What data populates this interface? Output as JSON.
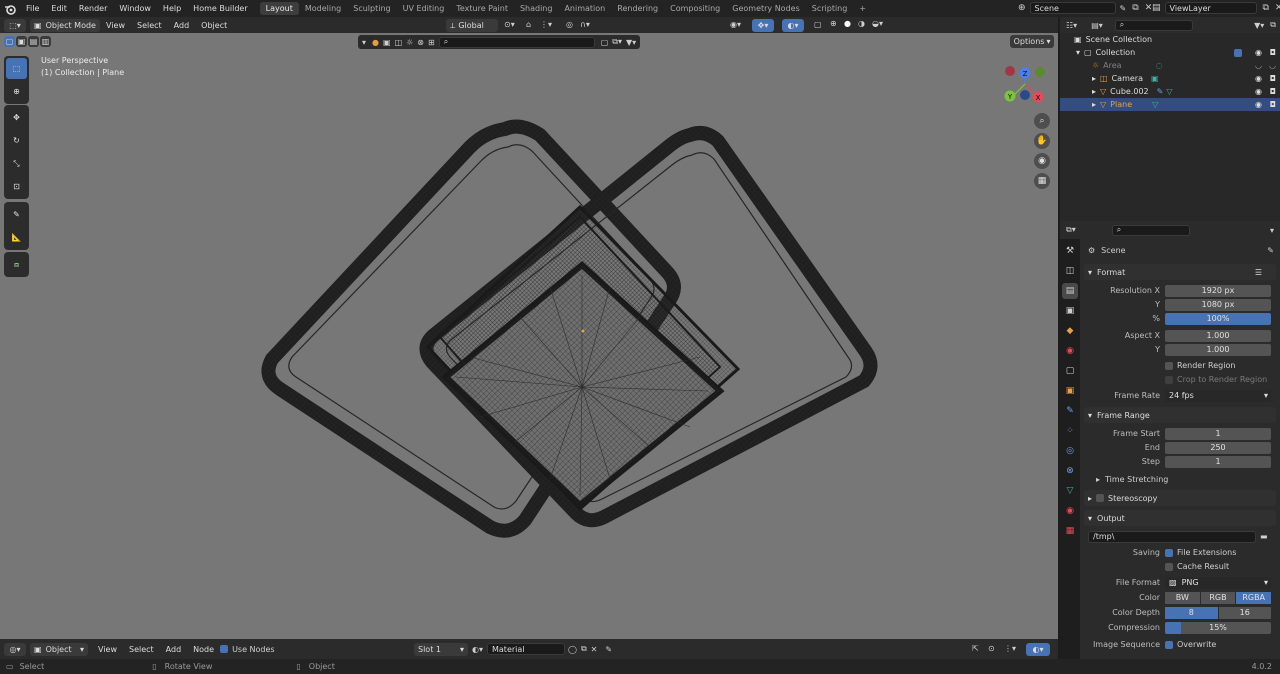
{
  "menus": [
    "File",
    "Edit",
    "Render",
    "Window",
    "Help",
    "Home Builder"
  ],
  "workspaces": [
    "Layout",
    "Modeling",
    "Sculpting",
    "UV Editing",
    "Texture Paint",
    "Shading",
    "Animation",
    "Rendering",
    "Compositing",
    "Geometry Nodes",
    "Scripting"
  ],
  "active_workspace": "Layout",
  "add_workspace": "+",
  "scene_name": "Scene",
  "view_layer": "ViewLayer",
  "viewport": {
    "mode": "Object Mode",
    "header_menus": [
      "View",
      "Select",
      "Add",
      "Object"
    ],
    "transform_orientation": "Global",
    "options_label": "Options",
    "perspective_label": "User Perspective",
    "collection_label": "(1) Collection | Plane",
    "gizmo_axes": {
      "x": "X",
      "y": "Y",
      "z": "Z"
    }
  },
  "bottom_bar": {
    "editor_mode": "Object",
    "menus": [
      "View",
      "Select",
      "Add",
      "Node"
    ],
    "use_nodes_label": "Use Nodes",
    "slot": "Slot 1",
    "material": "Material"
  },
  "status_bar": {
    "select": "Select",
    "rotate_view": "Rotate View",
    "object": "Object",
    "version": "4.0.2"
  },
  "outliner": {
    "scene_collection": "Scene Collection",
    "collection": "Collection",
    "items": [
      {
        "name": "Area",
        "dim": true
      },
      {
        "name": "Camera",
        "dim": false
      },
      {
        "name": "Cube.002",
        "dim": false
      },
      {
        "name": "Plane",
        "dim": false,
        "selected": true
      }
    ]
  },
  "properties": {
    "context": "Scene",
    "format_panel": {
      "title": "Format",
      "resolution_x_label": "Resolution X",
      "resolution_x": "1920 px",
      "y_label": "Y",
      "resolution_y": "1080 px",
      "percent_label": "%",
      "percent": "100%",
      "percent_fraction": 1.0,
      "aspect_x_label": "Aspect X",
      "aspect_x": "1.000",
      "aspect_y_label": "Y",
      "aspect_y": "1.000",
      "render_region": "Render Region",
      "crop_region": "Crop to Render Region",
      "frame_rate_label": "Frame Rate",
      "frame_rate": "24 fps"
    },
    "frame_range_panel": {
      "title": "Frame Range",
      "frame_start_label": "Frame Start",
      "frame_start": "1",
      "end_label": "End",
      "end": "250",
      "step_label": "Step",
      "step": "1",
      "time_stretching": "Time Stretching"
    },
    "stereoscopy_panel": {
      "title": "Stereoscopy"
    },
    "output_panel": {
      "title": "Output",
      "path": "/tmp\\",
      "saving_label": "Saving",
      "file_extensions": "File Extensions",
      "cache_result": "Cache Result",
      "file_format_label": "File Format",
      "file_format": "PNG",
      "color_label": "Color",
      "color_options": [
        "BW",
        "RGB",
        "RGBA"
      ],
      "color_selected": "RGBA",
      "color_depth_label": "Color Depth",
      "color_depth_options": [
        "8",
        "16"
      ],
      "color_depth_selected": "8",
      "compression_label": "Compression",
      "compression": "15%",
      "compression_fraction": 0.15,
      "image_sequence_label": "Image Sequence",
      "overwrite": "Overwrite"
    }
  },
  "colors": {
    "accent": "#4772b3",
    "viewport_bg": "#777777",
    "selected_row": "#334d80",
    "orange": "#e8a04a",
    "teal": "#3fb3a3"
  }
}
